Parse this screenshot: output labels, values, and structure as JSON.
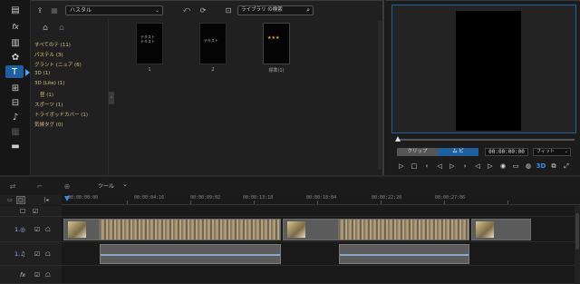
{
  "rail": {
    "items": [
      {
        "name": "media-room-icon",
        "glyph": "▤"
      },
      {
        "name": "fx-room-icon",
        "glyph": "fx"
      },
      {
        "name": "pip-room-icon",
        "glyph": "▥"
      },
      {
        "name": "particle-room-icon",
        "glyph": "✿"
      },
      {
        "name": "title-room-icon",
        "glyph": "T"
      },
      {
        "name": "transition-room-icon",
        "glyph": "⊞"
      },
      {
        "name": "chapter-room-icon",
        "glyph": "⊟"
      },
      {
        "name": "voiceover-room-icon",
        "glyph": "♪"
      },
      {
        "name": "audio-mixing-icon",
        "glyph": "▦"
      },
      {
        "name": "subtitle-room-icon",
        "glyph": "▬"
      }
    ]
  },
  "library": {
    "style_select": "ハスタル",
    "search_placeholder": "ライブラリ の検索",
    "categories": [
      {
        "label": "すべてのテ (11)",
        "sub": false,
        "sel": false
      },
      {
        "label": "パステル (3)",
        "sub": false,
        "sel": true
      },
      {
        "label": "グラント (ニュア (6)",
        "sub": false,
        "sel": false
      },
      {
        "label": "3D (1)",
        "sub": false,
        "sel": false
      },
      {
        "label": "3D (Lite) (1)",
        "sub": false,
        "sel": false
      },
      {
        "label": "昼 (1)",
        "sub": true,
        "sel": false
      },
      {
        "label": "スポーツ (1)",
        "sub": false,
        "sel": false
      },
      {
        "label": "トライボッドカバー (1)",
        "sub": false,
        "sel": false
      },
      {
        "label": "気候タグ (0)",
        "sub": false,
        "sel": false
      }
    ],
    "thumbnails": [
      {
        "label": "1",
        "text": "テキスト\nテキスト"
      },
      {
        "label": "2",
        "text": "テキスト"
      },
      {
        "label": "標準(1)",
        "text": "★★★"
      }
    ]
  },
  "preview": {
    "tabs": [
      "クリップ",
      "ム ビ"
    ],
    "active_tab": 1,
    "timecode": "00:00:00:00",
    "fit": "フィット",
    "progress": 0
  },
  "timeline": {
    "tool_label": "ツール",
    "ruler_ticks": [
      "00:00:00:00",
      "00:00:04:16",
      "00:00:09:02",
      "00:00:13:18",
      "00:00:18:04",
      "00:00:22:20",
      "00:00:27:06"
    ],
    "track_heads": [
      {
        "icons": [
          "☐",
          "☑"
        ],
        "tags": []
      },
      {
        "icons": [
          "☐",
          "☑",
          "☖"
        ],
        "tags": [
          "1.◎"
        ]
      },
      {
        "icons": [
          "☐",
          "☑",
          "☖"
        ],
        "tags": [
          "1.♫"
        ]
      },
      {
        "icons": [
          "☐",
          "☑",
          "☖"
        ],
        "tags": [
          "fx"
        ]
      }
    ]
  },
  "colors": {
    "accent": "#1f5f9e",
    "library_text": "#d6c08a",
    "playhead": "#3a8fe8"
  }
}
